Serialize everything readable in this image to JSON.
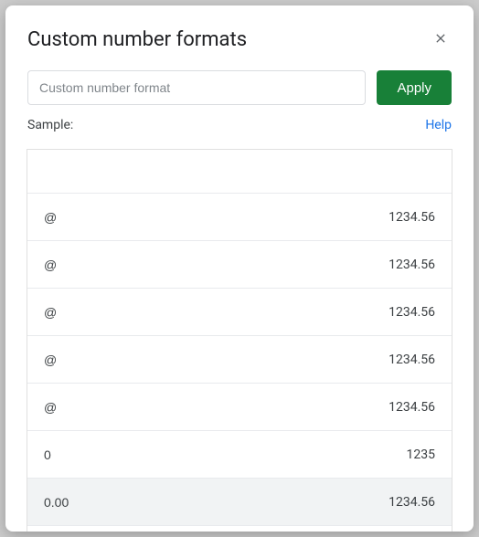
{
  "dialog": {
    "title": "Custom number formats",
    "input_placeholder": "Custom number format",
    "apply_label": "Apply",
    "sample_label": "Sample:",
    "help_label": "Help"
  },
  "formats": [
    {
      "pattern": "",
      "example": ""
    },
    {
      "pattern": "@",
      "example": "1234.56"
    },
    {
      "pattern": "@",
      "example": "1234.56"
    },
    {
      "pattern": "@",
      "example": "1234.56"
    },
    {
      "pattern": "@",
      "example": "1234.56"
    },
    {
      "pattern": "@",
      "example": "1234.56"
    },
    {
      "pattern": "0",
      "example": "1235"
    },
    {
      "pattern": "0.00",
      "example": "1234.56",
      "selected": true
    }
  ]
}
